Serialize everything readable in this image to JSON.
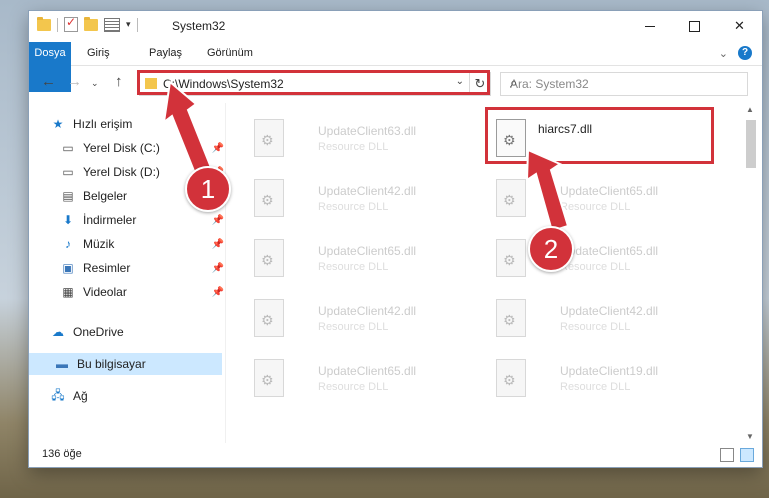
{
  "window": {
    "title": "System32",
    "min_label": "",
    "close_label": "✕"
  },
  "ribbon": {
    "tabs": [
      "Dosya",
      "Giriş",
      "Paylaş",
      "Görünüm"
    ],
    "help_label": "?"
  },
  "navbar": {
    "address": "C:\\Windows\\System32",
    "search_placeholder": "Ara: System32"
  },
  "sidebar": {
    "items": [
      {
        "label": "Hızlı erişim",
        "icon": "star-icon",
        "pinned": false
      },
      {
        "label": "Yerel Disk (C:)",
        "icon": "drive-icon",
        "pinned": true
      },
      {
        "label": "Yerel Disk (D:)",
        "icon": "drive-icon",
        "pinned": true
      },
      {
        "label": "Belgeler",
        "icon": "documents-icon",
        "pinned": true
      },
      {
        "label": "İndirmeler",
        "icon": "download-icon",
        "pinned": true
      },
      {
        "label": "Müzik",
        "icon": "music-icon",
        "pinned": true
      },
      {
        "label": "Resimler",
        "icon": "pictures-icon",
        "pinned": true
      },
      {
        "label": "Videolar",
        "icon": "videos-icon",
        "pinned": true
      },
      {
        "label": "OneDrive",
        "icon": "cloud-icon",
        "pinned": false
      },
      {
        "label": "Bu bilgisayar",
        "icon": "computer-icon",
        "pinned": false
      },
      {
        "label": "Ağ",
        "icon": "network-icon",
        "pinned": false
      }
    ]
  },
  "files": {
    "main": {
      "name": "hiarcs7.dll"
    },
    "left": [
      {
        "name": "UpdateClient63.dll",
        "type": "Resource DLL"
      },
      {
        "name": "UpdateClient42.dll",
        "type": "Resource DLL"
      },
      {
        "name": "UpdateClient65.dll",
        "type": "Resource DLL"
      },
      {
        "name": "UpdateClient42.dll",
        "type": "Resource DLL"
      },
      {
        "name": "UpdateClient65.dll",
        "type": "Resource DLL"
      }
    ],
    "right": [
      {
        "name": "UpdateClient65.dll",
        "type": "Resource DLL"
      },
      {
        "name": "UpdateClient65.dll",
        "type": "Resource DLL"
      },
      {
        "name": "UpdateClient42.dll",
        "type": "Resource DLL"
      },
      {
        "name": "UpdateClient19.dll",
        "type": "Resource DLL"
      }
    ]
  },
  "status": {
    "count": "136 öğe"
  },
  "annotations": {
    "step1": "1",
    "step2": "2",
    "accent": "#d2323a"
  }
}
